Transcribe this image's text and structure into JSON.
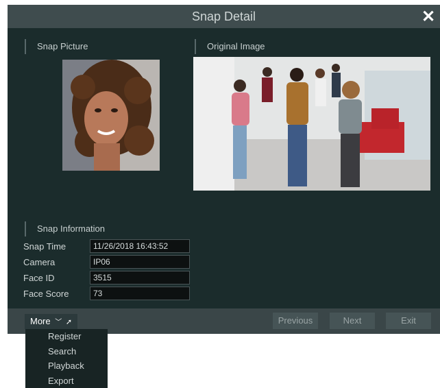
{
  "dialog": {
    "title": "Snap Detail",
    "close_icon": "close-icon"
  },
  "sections": {
    "snap_picture": "Snap Picture",
    "original_image": "Original Image",
    "snap_information": "Snap Information"
  },
  "info": [
    {
      "label": "Snap Time",
      "value": "11/26/2018 16:43:52"
    },
    {
      "label": "Camera",
      "value": "IP06"
    },
    {
      "label": "Face ID",
      "value": "3515"
    },
    {
      "label": "Face Score",
      "value": "73"
    }
  ],
  "footer": {
    "more_label": "More",
    "more_icon": "chevron-down-icon",
    "previous": "Previous",
    "next": "Next",
    "exit": "Exit"
  },
  "more_menu": [
    "Register",
    "Search",
    "Playback",
    "Export"
  ],
  "colors": {
    "dialog_bg": "#1b2c2c",
    "titlebar_bg": "#3f4c4e",
    "footer_bg": "#3a4648",
    "field_bg": "#0d1111",
    "menu_bg": "#182424"
  }
}
